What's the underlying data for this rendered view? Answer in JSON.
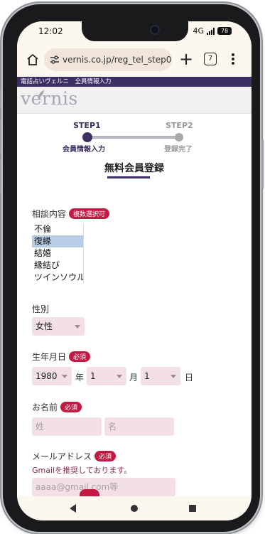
{
  "status": {
    "time": "12:02",
    "network": "4G",
    "battery": "78"
  },
  "browser": {
    "url": "vernis.co.jp/reg_tel_step01.ph",
    "tab_count": "7"
  },
  "site": {
    "strip_text": "電話占いヴェルニ　全員情報入力",
    "logo": "vernis"
  },
  "steps": {
    "step1_label": "STEP1",
    "step1_sub": "会員情報入力",
    "step2_label": "STEP2",
    "step2_sub": "登録完了"
  },
  "form": {
    "title": "無料会員登録",
    "consult": {
      "label": "相談内容",
      "badge": "複数選択可",
      "options": [
        "不倫",
        "復縁",
        "結婚",
        "縁結び",
        "ツインソウル"
      ],
      "selected": "復縁"
    },
    "gender": {
      "label": "性別",
      "value": "女性"
    },
    "birthday": {
      "label": "生年月日",
      "badge": "必須",
      "year": "1980",
      "year_suffix": "年",
      "month": "1",
      "month_suffix": "月",
      "day": "1",
      "day_suffix": "日"
    },
    "name": {
      "label": "お名前",
      "badge": "必須",
      "last_placeholder": "姓",
      "first_placeholder": "名"
    },
    "email": {
      "label": "メールアドレス",
      "badge": "必須",
      "note": "Gmailを推奨しております。",
      "placeholder": "aaaa@gmail.com等"
    }
  },
  "colors": {
    "brand": "#3d2f63",
    "badge": "#c21a43",
    "field_bg": "#f3dfe6",
    "selected_option": "#b7cde6"
  }
}
